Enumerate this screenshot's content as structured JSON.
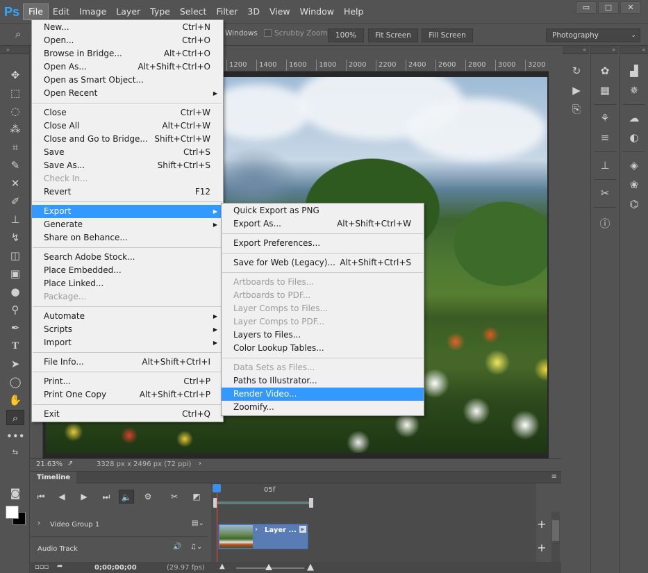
{
  "app": {
    "logo": "Ps"
  },
  "menubar": {
    "items": [
      "File",
      "Edit",
      "Image",
      "Layer",
      "Type",
      "Select",
      "Filter",
      "3D",
      "View",
      "Window",
      "Help"
    ],
    "active": "File"
  },
  "window_controls": {
    "minimize": "▭",
    "restore": "□",
    "close": "✕"
  },
  "options_bar": {
    "windows_label": "Windows",
    "scrubby_zoom": "Scrubby Zoom",
    "zoom_100": "100%",
    "fit_screen": "Fit Screen",
    "fill_screen": "Fill Screen",
    "workspace": "Photography"
  },
  "ruler": {
    "ticks": [
      "1200",
      "1400",
      "1600",
      "1800",
      "2000",
      "2200",
      "2400",
      "2600",
      "2800",
      "3000",
      "3200"
    ]
  },
  "status": {
    "zoom": "21.63%",
    "doc_info": "3328 px x 2496 px (72 ppi)"
  },
  "timeline": {
    "tab": "Timeline",
    "time_marker": "05f",
    "tracks": [
      {
        "name": "Video Group 1"
      },
      {
        "name": "Audio Track"
      }
    ],
    "clip_label": "Layer ...",
    "timecode": "0;00;00;00",
    "fps": "(29.97 fps)"
  },
  "file_menu": {
    "groups": [
      [
        {
          "label": "New...",
          "shortcut": "Ctrl+N"
        },
        {
          "label": "Open...",
          "shortcut": "Ctrl+O"
        },
        {
          "label": "Browse in Bridge...",
          "shortcut": "Alt+Ctrl+O"
        },
        {
          "label": "Open As...",
          "shortcut": "Alt+Shift+Ctrl+O"
        },
        {
          "label": "Open as Smart Object...",
          "shortcut": ""
        },
        {
          "label": "Open Recent",
          "shortcut": "",
          "submenu": true
        }
      ],
      [
        {
          "label": "Close",
          "shortcut": "Ctrl+W"
        },
        {
          "label": "Close All",
          "shortcut": "Alt+Ctrl+W"
        },
        {
          "label": "Close and Go to Bridge...",
          "shortcut": "Shift+Ctrl+W"
        },
        {
          "label": "Save",
          "shortcut": "Ctrl+S"
        },
        {
          "label": "Save As...",
          "shortcut": "Shift+Ctrl+S"
        },
        {
          "label": "Check In...",
          "shortcut": "",
          "disabled": true
        },
        {
          "label": "Revert",
          "shortcut": "F12"
        }
      ],
      [
        {
          "label": "Export",
          "shortcut": "",
          "submenu": true,
          "highlight": true
        },
        {
          "label": "Generate",
          "shortcut": "",
          "submenu": true
        },
        {
          "label": "Share on Behance...",
          "shortcut": ""
        }
      ],
      [
        {
          "label": "Search Adobe Stock...",
          "shortcut": ""
        },
        {
          "label": "Place Embedded...",
          "shortcut": ""
        },
        {
          "label": "Place Linked...",
          "shortcut": ""
        },
        {
          "label": "Package...",
          "shortcut": "",
          "disabled": true
        }
      ],
      [
        {
          "label": "Automate",
          "shortcut": "",
          "submenu": true
        },
        {
          "label": "Scripts",
          "shortcut": "",
          "submenu": true
        },
        {
          "label": "Import",
          "shortcut": "",
          "submenu": true
        }
      ],
      [
        {
          "label": "File Info...",
          "shortcut": "Alt+Shift+Ctrl+I"
        }
      ],
      [
        {
          "label": "Print...",
          "shortcut": "Ctrl+P"
        },
        {
          "label": "Print One Copy",
          "shortcut": "Alt+Shift+Ctrl+P"
        }
      ],
      [
        {
          "label": "Exit",
          "shortcut": "Ctrl+Q"
        }
      ]
    ]
  },
  "export_menu": {
    "groups": [
      [
        {
          "label": "Quick Export as PNG",
          "shortcut": ""
        },
        {
          "label": "Export As...",
          "shortcut": "Alt+Shift+Ctrl+W"
        }
      ],
      [
        {
          "label": "Export Preferences...",
          "shortcut": ""
        }
      ],
      [
        {
          "label": "Save for Web (Legacy)...",
          "shortcut": "Alt+Shift+Ctrl+S"
        }
      ],
      [
        {
          "label": "Artboards to Files...",
          "shortcut": "",
          "disabled": true
        },
        {
          "label": "Artboards to PDF...",
          "shortcut": "",
          "disabled": true
        },
        {
          "label": "Layer Comps to Files...",
          "shortcut": "",
          "disabled": true
        },
        {
          "label": "Layer Comps to PDF...",
          "shortcut": "",
          "disabled": true
        },
        {
          "label": "Layers to Files...",
          "shortcut": ""
        },
        {
          "label": "Color Lookup Tables...",
          "shortcut": ""
        }
      ],
      [
        {
          "label": "Data Sets as Files...",
          "shortcut": "",
          "disabled": true
        },
        {
          "label": "Paths to Illustrator...",
          "shortcut": ""
        },
        {
          "label": "Render Video...",
          "shortcut": "",
          "highlight": true
        },
        {
          "label": "Zoomify...",
          "shortcut": ""
        }
      ]
    ]
  }
}
